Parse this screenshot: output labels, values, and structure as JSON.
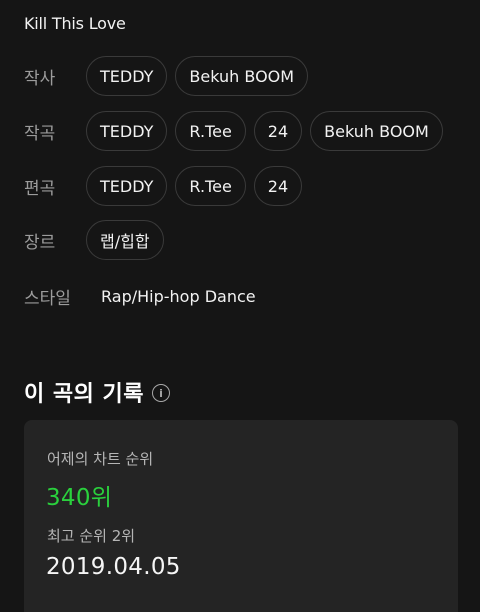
{
  "song": {
    "title": "Kill This Love"
  },
  "credits": {
    "lyricist": {
      "label": "작사",
      "names": [
        "TEDDY",
        "Bekuh BOOM"
      ]
    },
    "composer": {
      "label": "작곡",
      "names": [
        "TEDDY",
        "R.Tee",
        "24",
        "Bekuh BOOM"
      ]
    },
    "arranger": {
      "label": "편곡",
      "names": [
        "TEDDY",
        "R.Tee",
        "24"
      ]
    },
    "genre": {
      "label": "장르",
      "names": [
        "랩/힙합"
      ]
    },
    "style": {
      "label": "스타일",
      "value": "Rap/Hip-hop Dance"
    }
  },
  "records": {
    "title": "이 곡의 기록",
    "info_icon": "info-icon",
    "yesterday_rank_label": "어제의 차트 순위",
    "yesterday_rank_value": "340위",
    "best_rank_label": "최고 순위 2위",
    "best_rank_date": "2019.04.05"
  },
  "colors": {
    "background": "#151515",
    "card": "#242424",
    "accent_green": "#2ad03d",
    "chip_border": "#3a3a3a",
    "label_gray": "#9c9c9c"
  }
}
